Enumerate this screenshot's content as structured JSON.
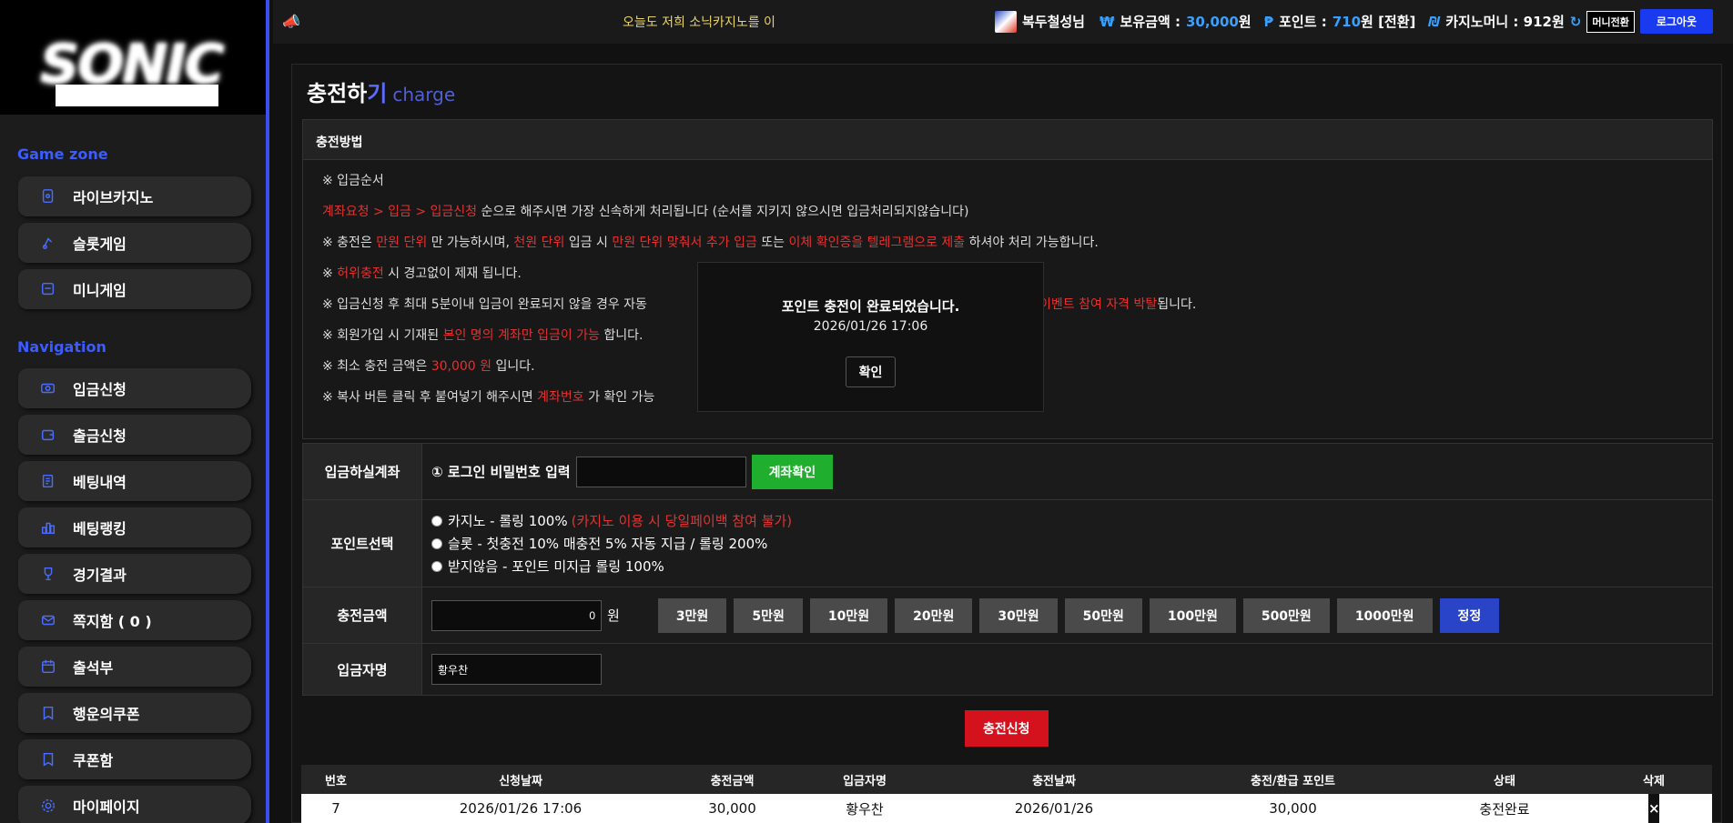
{
  "topbar": {
    "marquee": "오늘도 저희 소닉카지노를 이",
    "username": "복두철성님",
    "balance_label": "보유금액 :",
    "balance_value": "30,000",
    "won": "원",
    "point_label": "포인트 :",
    "point_value": "710",
    "point_suffix": "원 [전환]",
    "casino_label": "카지노머니 : 912원",
    "money_convert": "머니전환",
    "logout": "로그아웃"
  },
  "sidebar": {
    "section_game": "Game zone",
    "section_nav": "Navigation",
    "game_items": [
      {
        "label": "라이브카지노",
        "icon": "cards-icon"
      },
      {
        "label": "슬롯게임",
        "icon": "slot-icon"
      },
      {
        "label": "미니게임",
        "icon": "mini-game-icon"
      }
    ],
    "nav_items": [
      {
        "label": "입금신청",
        "icon": "deposit-icon"
      },
      {
        "label": "출금신청",
        "icon": "wallet-icon"
      },
      {
        "label": "베팅내역",
        "icon": "history-icon"
      },
      {
        "label": "베팅랭킹",
        "icon": "ranking-icon"
      },
      {
        "label": "경기결과",
        "icon": "trophy-icon"
      },
      {
        "label": "쪽지함 ( 0 )",
        "icon": "message-icon"
      },
      {
        "label": "출석부",
        "icon": "calendar-icon"
      },
      {
        "label": "행운의쿠폰",
        "icon": "coupon-icon"
      },
      {
        "label": "쿠폰함",
        "icon": "coupon-box-icon"
      },
      {
        "label": "마이페이지",
        "icon": "gear-icon"
      }
    ]
  },
  "page": {
    "title_main": "충전하",
    "title_accent": "기",
    "title_sub": "charge"
  },
  "howto": {
    "heading": "충전방법",
    "l1": "※ 입금순서",
    "l2_red": "계좌요청 > 입금 > 입금신청",
    "l2_rest": " 순으로 해주시면 가장 신속하게 처리됩니다 (순서를 지키지 않으시면 입금처리되지않습니다)",
    "l3_a": "※ 충전은 ",
    "l3_r1": "만원 단위",
    "l3_b": " 만 가능하시며, ",
    "l3_r2": "천원 단위",
    "l3_c": " 입금 시 ",
    "l3_r3": "만원 단위 맞춰서 추가 입금",
    "l3_d": " 또는 ",
    "l3_r4": "이체 확인증을 텔레그램으로 제출",
    "l3_e": " 하셔야 처리 가능합니다.",
    "l4_a": "※ ",
    "l4_r": "허위충전",
    "l4_b": " 시 경고없이 제재 됩니다.",
    "l5_a": "※ 입금신청 후 최대 5분이내 입금이 완료되지 않을 경우 자동",
    "l5_r": "이벤트 참여 자격 박탈",
    "l5_b": "됩니다.",
    "l6_a": "※ 회원가입 시 기재된 ",
    "l6_r": "본인 명의 계좌만 입금이 가능",
    "l6_b": " 합니다.",
    "l7_a": "※ 최소 충전 금액은 ",
    "l7_r": "30,000 원",
    "l7_b": " 입니다.",
    "l8_a": "※ 복사 버튼 클릭 후 붙여넣기 해주시면 ",
    "l8_r": "계좌번호",
    "l8_b": " 가 확인 가능"
  },
  "popup": {
    "title": "포인트 충전이 완료되었습니다.",
    "date": "2026/01/26 17:06",
    "ok": "확인"
  },
  "form": {
    "account_label": "입금하실계좌",
    "pw_label": "① 로그인 비밀번호 입력",
    "pw_value": "",
    "account_check": "계좌확인",
    "point_label": "포인트선택",
    "opt1": "카지노 - 롤링 100% ",
    "opt1_red": "(카지노 이용 시 당일페이백 참여 불가)",
    "opt2": "슬롯 - 첫충전 10% 매충전 5% 자동 지급 / 롤링 200%",
    "opt3": "받지않음 - 포인트 미지급 롤링 100%",
    "amount_label": "충전금액",
    "amount_value": "0",
    "amount_unit": "원",
    "amount_buttons": [
      "3만원",
      "5만원",
      "10만원",
      "20만원",
      "30만원",
      "50만원",
      "100만원",
      "500만원",
      "1000만원"
    ],
    "reset": "정정",
    "depositor_label": "입금자명",
    "depositor_value": "황우찬",
    "submit": "충전신청"
  },
  "list": {
    "headers": [
      "번호",
      "신청날짜",
      "충전금액",
      "입금자명",
      "충전날짜",
      "충전/환급 포인트",
      "상태",
      "삭제"
    ],
    "rows": [
      [
        "7",
        "2026/01/26 17:06",
        "30,000",
        "황우찬",
        "2026/01/26",
        "30,000",
        "충전완료",
        "×"
      ]
    ]
  }
}
